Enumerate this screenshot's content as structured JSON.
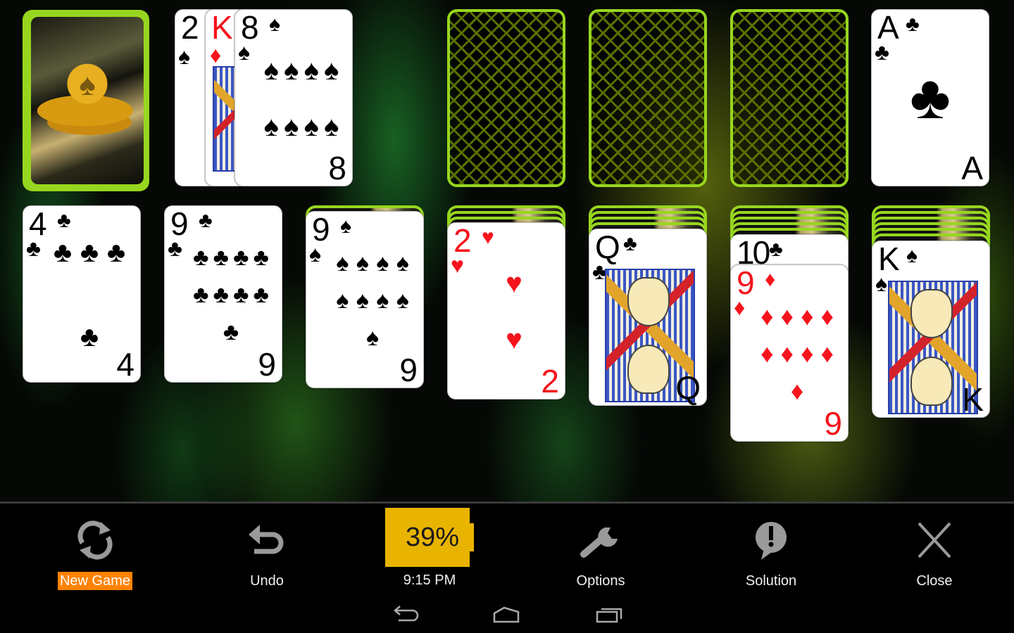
{
  "game": {
    "name": "Solitaire",
    "stock": {
      "icon": "golden-spade-chips-card-back"
    },
    "waste": [
      {
        "rank": "2",
        "suit": "spades",
        "symbol": "♠",
        "color": "black"
      },
      {
        "rank": "K",
        "suit": "diamonds",
        "symbol": "♦",
        "color": "red"
      },
      {
        "rank": "8",
        "suit": "spades",
        "symbol": "♠",
        "color": "black"
      }
    ],
    "foundations": [
      {
        "empty": true
      },
      {
        "empty": true
      },
      {
        "empty": true
      },
      {
        "empty": false,
        "rank": "A",
        "suit": "clubs",
        "symbol": "♣",
        "color": "black"
      }
    ],
    "tableau": [
      {
        "facedown": 0,
        "faceup": [
          {
            "rank": "4",
            "suit": "clubs",
            "symbol": "♣",
            "color": "black",
            "pips": "♣♣♣♣"
          }
        ]
      },
      {
        "facedown": 0,
        "faceup": [
          {
            "rank": "9",
            "suit": "clubs",
            "symbol": "♣",
            "color": "black",
            "pips": "♣♣♣♣♣♣♣♣♣"
          }
        ]
      },
      {
        "facedown": 1,
        "faceup": [
          {
            "rank": "9",
            "suit": "spades",
            "symbol": "♠",
            "color": "black",
            "pips": "♠♠♠♠♠♠♠♠♠"
          }
        ]
      },
      {
        "facedown": 3,
        "faceup": [
          {
            "rank": "2",
            "suit": "hearts",
            "symbol": "♥",
            "color": "red",
            "pips": "♥♥"
          }
        ]
      },
      {
        "facedown": 4,
        "faceup": [
          {
            "rank": "Q",
            "suit": "clubs",
            "symbol": "♣",
            "color": "black",
            "face": true
          }
        ]
      },
      {
        "facedown": 5,
        "faceup": [
          {
            "rank": "10",
            "suit": "clubs",
            "symbol": "♣",
            "color": "black"
          },
          {
            "rank": "9",
            "suit": "diamonds",
            "symbol": "♦",
            "color": "red",
            "pips": "♦♦♦♦♦♦♦♦♦"
          }
        ]
      },
      {
        "facedown": 6,
        "faceup": [
          {
            "rank": "K",
            "suit": "spades",
            "symbol": "♠",
            "color": "black",
            "face": true
          }
        ]
      }
    ]
  },
  "toolbar": {
    "new_game": "New Game",
    "undo": "Undo",
    "battery": "39%",
    "time": "9:15 PM",
    "options": "Options",
    "solution": "Solution",
    "close": "Close"
  },
  "colors": {
    "accent_green": "#97d61f",
    "new_game_highlight": "#ff8200",
    "battery_yellow": "#e8b400",
    "red_suit": "#f5141c"
  }
}
